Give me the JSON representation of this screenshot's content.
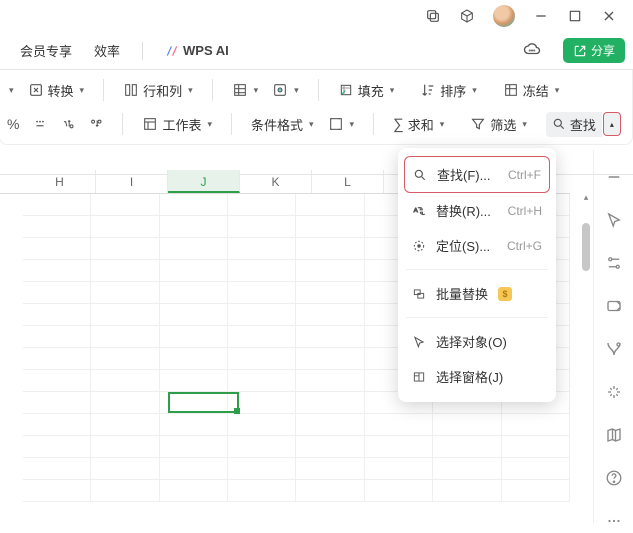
{
  "titlebar": {
    "copy_icon": "copy-icon",
    "cube_icon": "package-icon",
    "min_icon": "minimize-icon",
    "max_icon": "maximize-icon",
    "close_icon": "close-icon"
  },
  "menubar": {
    "member": "会员专享",
    "efficiency": "效率",
    "ai_label": "WPS AI",
    "share": "分享"
  },
  "ribbon": {
    "convert": "转换",
    "rowscols": "行和列",
    "sheet": "工作表",
    "condfmt": "条件格式",
    "fill": "填充",
    "sum": "求和",
    "sort": "排序",
    "filter": "筛选",
    "freeze": "冻结",
    "find": "查找"
  },
  "dropdown": {
    "find": {
      "label": "查找(F)...",
      "shortcut": "Ctrl+F"
    },
    "replace": {
      "label": "替换(R)...",
      "shortcut": "Ctrl+H"
    },
    "goto": {
      "label": "定位(S)...",
      "shortcut": "Ctrl+G"
    },
    "batch": {
      "label": "批量替换"
    },
    "selobj": {
      "label": "选择对象(O)"
    },
    "selpane": {
      "label": "选择窗格(J)"
    }
  },
  "columns": [
    "H",
    "I",
    "J",
    "K",
    "L"
  ],
  "selected_col_index": 2,
  "selected_cell": {
    "col": 2,
    "row": 9
  }
}
